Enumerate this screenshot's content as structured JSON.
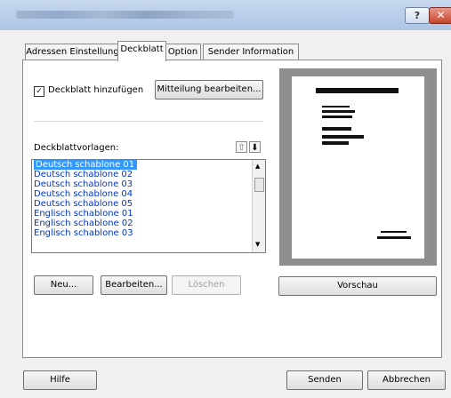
{
  "window": {
    "help_label": "?",
    "close_label": "✕"
  },
  "tabs": [
    {
      "label": "Adressen Einstellung"
    },
    {
      "label": "Deckblatt"
    },
    {
      "label": "Option"
    },
    {
      "label": "Sender Information"
    }
  ],
  "deckblatt": {
    "checkbox_label": "Deckblatt hinzufügen",
    "checkbox_checked": true,
    "edit_message_button": "Mitteilung bearbeiten...",
    "templates_label": "Deckblattvorlagen:",
    "move_up_icon": "arrow-up-icon",
    "move_down_icon": "arrow-down-icon",
    "templates": [
      "Deutsch schablone 01",
      "Deutsch schablone 02",
      "Deutsch schablone 03",
      "Deutsch schablone 04",
      "Deutsch schablone 05",
      "Englisch schablone 01",
      "Englisch schablone 02",
      "Englisch schablone 03"
    ],
    "selected_index": 0,
    "new_button": "Neu...",
    "edit_button": "Bearbeiten...",
    "delete_button": "Löschen",
    "preview_button": "Vorschau"
  },
  "footer": {
    "help_button": "Hilfe",
    "send_button": "Senden",
    "cancel_button": "Abbrechen"
  },
  "colors": {
    "selection": "#3399ff",
    "list_text": "#0033cc",
    "preview_bg": "#8e8e8e"
  }
}
